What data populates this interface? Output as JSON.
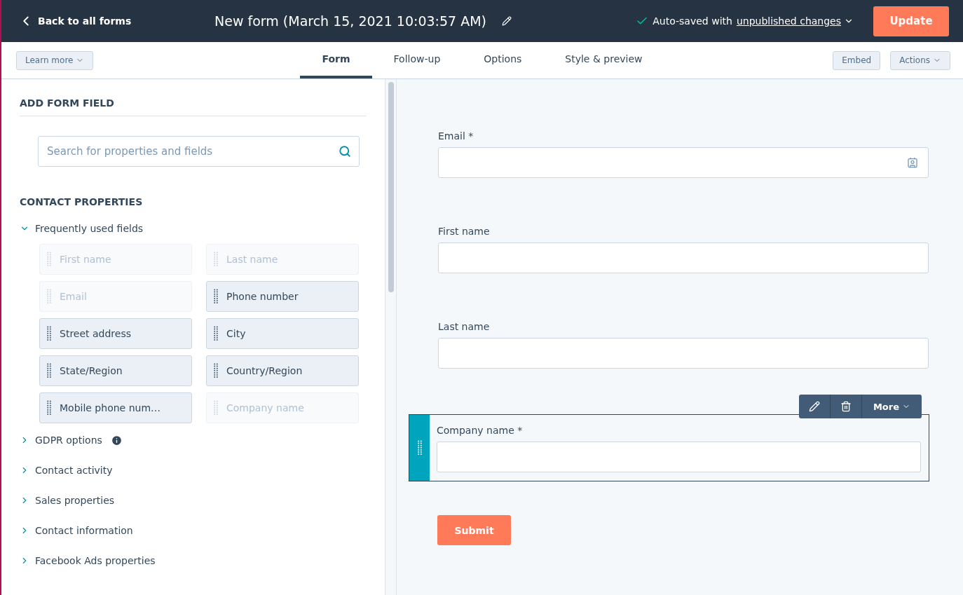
{
  "header": {
    "back_link": "Back to all forms",
    "title": "New form (March 15, 2021 10:03:57 AM)",
    "save_status": "Auto-saved with",
    "save_link": "unpublished changes",
    "update_button": "Update"
  },
  "toolbar": {
    "learn_more": "Learn more",
    "tabs": [
      {
        "label": "Form",
        "selected": true
      },
      {
        "label": "Follow-up",
        "selected": false
      },
      {
        "label": "Options",
        "selected": false
      },
      {
        "label": "Style & preview",
        "selected": false
      }
    ],
    "embed": "Embed",
    "actions": "Actions"
  },
  "sidebar": {
    "heading": "ADD FORM FIELD",
    "search": {
      "placeholder": "Search for properties and fields"
    },
    "section_heading": "CONTACT PROPERTIES",
    "groups": [
      {
        "label": "Frequently used fields",
        "expanded": true,
        "info": false,
        "children": [
          {
            "label": "First name",
            "disabled": true
          },
          {
            "label": "Last name",
            "disabled": true
          },
          {
            "label": "Email",
            "disabled": true
          },
          {
            "label": "Phone number",
            "disabled": false
          },
          {
            "label": "Street address",
            "disabled": false
          },
          {
            "label": "City",
            "disabled": false
          },
          {
            "label": "State/Region",
            "disabled": false
          },
          {
            "label": "Country/Region",
            "disabled": false
          },
          {
            "label": "Mobile phone num…",
            "disabled": false
          },
          {
            "label": "Company name",
            "disabled": true
          }
        ]
      },
      {
        "label": "GDPR options",
        "expanded": false,
        "info": true
      },
      {
        "label": "Contact activity",
        "expanded": false,
        "info": false
      },
      {
        "label": "Sales properties",
        "expanded": false,
        "info": false
      },
      {
        "label": "Contact information",
        "expanded": false,
        "info": false
      },
      {
        "label": "Facebook Ads properties",
        "expanded": false,
        "info": false
      }
    ]
  },
  "form": {
    "fields": [
      {
        "label": "Email *",
        "selected": false,
        "contact_icon": true
      },
      {
        "label": "First name",
        "selected": false,
        "contact_icon": false
      },
      {
        "label": "Last name",
        "selected": false,
        "contact_icon": false
      },
      {
        "label": "Company name *",
        "selected": true,
        "contact_icon": false
      }
    ],
    "field_toolbar": {
      "more": "More"
    },
    "submit": "Submit"
  }
}
